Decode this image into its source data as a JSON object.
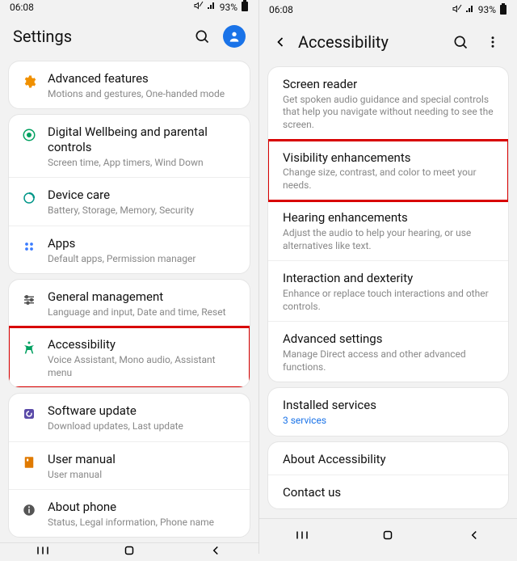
{
  "statusbar": {
    "time": "06:08",
    "battery": "93%"
  },
  "left": {
    "title": "Settings",
    "groups": [
      {
        "items": [
          {
            "icon": "gear-icon",
            "color": "accent-orange",
            "title": "Advanced features",
            "sub": "Motions and gestures, One-handed mode"
          }
        ]
      },
      {
        "items": [
          {
            "icon": "wellbeing-icon",
            "color": "accent-green",
            "title": "Digital Wellbeing and parental controls",
            "sub": "Screen time, App timers, Wind Down"
          },
          {
            "icon": "devicecare-icon",
            "color": "accent-teal",
            "title": "Device care",
            "sub": "Battery, Storage, Memory, Security"
          },
          {
            "icon": "apps-icon",
            "color": "accent-blue",
            "title": "Apps",
            "sub": "Default apps, Permission manager"
          }
        ]
      },
      {
        "items": [
          {
            "icon": "sliders-icon",
            "color": "accent-gray",
            "title": "General management",
            "sub": "Language and input, Date and time, Reset"
          },
          {
            "icon": "accessibility-icon",
            "color": "accent-green",
            "title": "Accessibility",
            "sub": "Voice Assistant, Mono audio, Assistant menu",
            "highlight": true
          }
        ]
      },
      {
        "items": [
          {
            "icon": "update-icon",
            "color": "accent-purple",
            "title": "Software update",
            "sub": "Download updates, Last update"
          },
          {
            "icon": "manual-icon",
            "color": "accent-or2",
            "title": "User manual",
            "sub": "User manual"
          },
          {
            "icon": "info-icon",
            "color": "accent-gray",
            "title": "About phone",
            "sub": "Status, Legal information, Phone name"
          }
        ]
      }
    ]
  },
  "right": {
    "title": "Accessibility",
    "groups": [
      {
        "items": [
          {
            "title": "Screen reader",
            "sub": "Get spoken audio guidance and special controls that help you navigate without needing to see the screen."
          },
          {
            "title": "Visibility enhancements",
            "sub": "Change size, contrast, and color to meet your needs.",
            "highlight": true
          },
          {
            "title": "Hearing enhancements",
            "sub": "Adjust the audio to help your hearing, or use alternatives like text."
          },
          {
            "title": "Interaction and dexterity",
            "sub": "Enhance or replace touch interactions and other controls."
          },
          {
            "title": "Advanced settings",
            "sub": "Manage Direct access and other advanced functions."
          }
        ]
      },
      {
        "items": [
          {
            "title": "Installed services",
            "sub": "3 services",
            "subLink": true
          }
        ]
      },
      {
        "items": [
          {
            "title": "About Accessibility"
          },
          {
            "title": "Contact us"
          }
        ]
      }
    ]
  }
}
